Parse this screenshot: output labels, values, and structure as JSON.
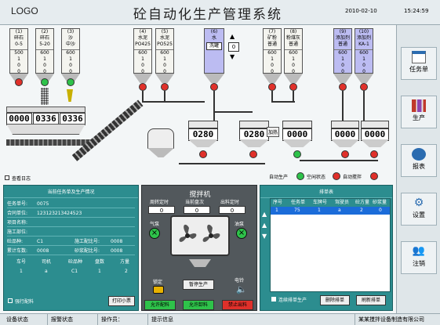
{
  "header": {
    "logo": "LOGO",
    "title": "砼自动化生产管理系统",
    "date": "2010-02-10",
    "time": "15:24:59"
  },
  "aggregates": [
    {
      "no": "(1)",
      "name": "碎石",
      "spec": "0-5",
      "val1": "500",
      "val2": "1",
      "val3": "0",
      "val4": "0",
      "reading": "0000"
    },
    {
      "no": "(2)",
      "name": "碎石",
      "spec": "5-20",
      "val1": "600",
      "val2": "1",
      "val3": "0",
      "val4": "0",
      "reading": "0336"
    },
    {
      "no": "(3)",
      "name": "沙",
      "spec": "中沙",
      "val1": "600",
      "val2": "1",
      "val3": "0",
      "val4": "0",
      "reading": "0336"
    }
  ],
  "cements": [
    {
      "no": "(4)",
      "name": "水泥",
      "spec": "PO425",
      "val1": "600",
      "val2": "1",
      "val3": "0",
      "val4": "0"
    },
    {
      "no": "(5)",
      "name": "水泥",
      "spec": "PO525",
      "val1": "600",
      "val2": "1",
      "val3": "0",
      "val4": "0"
    }
  ],
  "water": {
    "no": "(6)",
    "name": "水",
    "spec": "洗罐",
    "stepper": "0"
  },
  "additives": [
    {
      "no": "(7)",
      "name": "矿粉",
      "spec": "普通",
      "val1": "600",
      "val2": "1",
      "val3": "0",
      "val4": "0"
    },
    {
      "no": "(8)",
      "name": "粉煤灰",
      "spec": "普通",
      "val1": "600",
      "val2": "1",
      "val3": "0",
      "val4": "0"
    },
    {
      "no": "(9)",
      "name": "添加剂",
      "spec": "普通",
      "val1": "600",
      "val2": "1",
      "val3": "0",
      "val4": "0"
    },
    {
      "no": "(10)",
      "name": "添加剂",
      "spec": "KA-1",
      "val1": "600",
      "val2": "1",
      "val3": "0",
      "val4": "0"
    }
  ],
  "readings": {
    "cement": "0280",
    "water": "0280",
    "powder": "0000",
    "add1": "0000",
    "add2": "0000"
  },
  "tag_heat": "加热",
  "legend": {
    "auto": "自动生产",
    "idle": "空闲状态",
    "auto_mix": "自动搅拌"
  },
  "view_log": "查看日志",
  "task": {
    "title": "当前任务单及生产情况",
    "rows": [
      {
        "l": "任务单号:",
        "v": "0075"
      },
      {
        "l": "合同单位:",
        "v": "123123213424523"
      },
      {
        "l": "项目名称:",
        "v": ""
      },
      {
        "l": "施工部位:",
        "v": ""
      }
    ],
    "grade_l": "砼品种:",
    "grade_v": "C1",
    "mix_l": "施工配比号:",
    "mix_v": "0008",
    "total_l": "累计车数:",
    "total_v": "0008",
    "mortar_l": "砂浆配比号:",
    "mortar_v": "0008",
    "cols": [
      "车号",
      "司机",
      "砼品种",
      "盘数",
      "方量"
    ],
    "vals": [
      "1",
      "a",
      "C1",
      "1",
      "2"
    ],
    "force": "强行配料",
    "print": "打印小票"
  },
  "mixer": {
    "title": "搅拌机",
    "lbl1": "周转定时",
    "lbl2": "当前盘次",
    "lbl3": "出料定时",
    "v1": "0",
    "v2": "0",
    "v3": "0",
    "airpump": "气泵",
    "oilpump": "油泵",
    "lock": "锁定",
    "pause": "暂停生产",
    "bell": "电铃",
    "allow1": "允许配料",
    "allow2": "允许卸料",
    "prohibit": "禁止出料"
  },
  "queue": {
    "title": "排单表",
    "cols": [
      "序号",
      "任务单",
      "车牌号",
      "驾驶员",
      "砼方量",
      "砂浆量"
    ],
    "row": [
      "1",
      "75",
      "1",
      "a",
      "2",
      "0"
    ],
    "continuous": "连续排单生产",
    "delete": "删除排单",
    "refresh": "刷新排单"
  },
  "sidebar": [
    "任务单",
    "生产",
    "报表",
    "设置",
    "注销"
  ],
  "status": [
    "设备状态",
    "报警状态",
    "操作员：",
    "提示信息",
    "某某搅拌设备制造有限公司"
  ]
}
